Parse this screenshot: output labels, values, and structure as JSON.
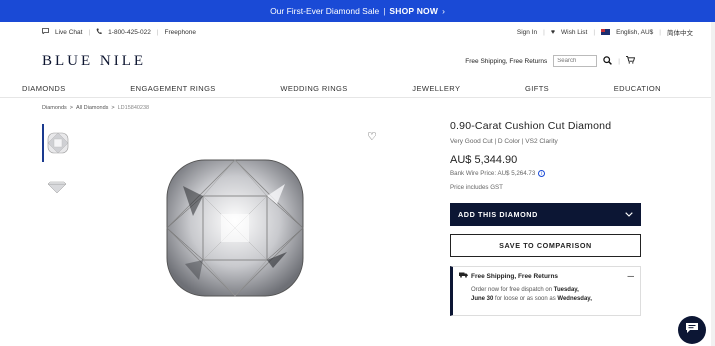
{
  "promo": {
    "text": "Our First-Ever Diamond Sale",
    "separator": "|",
    "cta": "SHOP NOW",
    "cta_arrow": "›"
  },
  "utility": {
    "live_chat": "Live Chat",
    "phone": "1-800-425-022",
    "freephone": "Freephone",
    "sign_in": "Sign In",
    "wish_list": "Wish List",
    "locale": "English, AU$",
    "chinese": "简体中文"
  },
  "brand": {
    "logo": "BLUE NILE",
    "shipping": "Free Shipping, Free Returns",
    "search_placeholder": "Search"
  },
  "nav": [
    "DIAMONDS",
    "ENGAGEMENT RINGS",
    "WEDDING RINGS",
    "JEWELLERY",
    "GIFTS",
    "EDUCATION"
  ],
  "breadcrumb": {
    "home": "Diamonds",
    "sep": ">",
    "all": "All Diamonds",
    "current": "LD15840238"
  },
  "product": {
    "title": "0.90-Carat Cushion Cut Diamond",
    "specs": "Very Good Cut | D Color | VS2 Clarity",
    "price": "AU$ 5,344.90",
    "wire_price": "Bank Wire Price: AU$ 5,264.73",
    "gst": "Price includes GST",
    "add_button": "ADD THIS DIAMOND",
    "compare_button": "SAVE TO COMPARISON"
  },
  "shipping_box": {
    "title": "Free Shipping, Free Returns",
    "line1": "Order now for free dispatch on",
    "date1": "Tuesday,",
    "date2": "June 30",
    "line2": "for loose or as soon as",
    "date3": "Wednesday,"
  },
  "colors": {
    "promo_bg": "#1a4ad6",
    "primary_dark": "#0c1634"
  }
}
